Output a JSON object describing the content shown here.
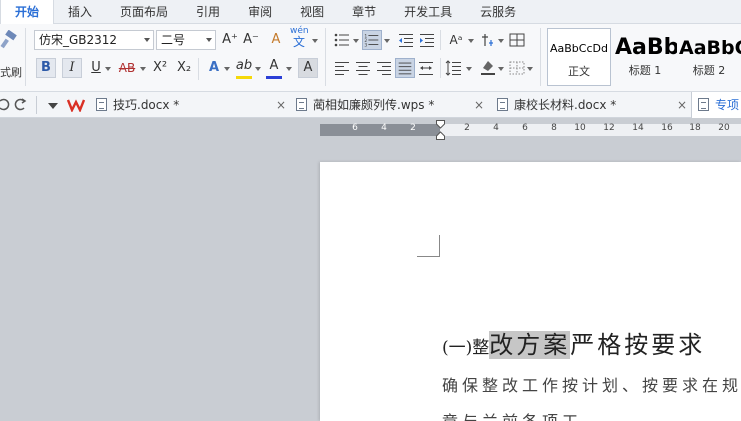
{
  "menu": {
    "tabs": [
      "开始",
      "插入",
      "页面布局",
      "引用",
      "审阅",
      "视图",
      "章节",
      "开发工具",
      "云服务"
    ],
    "active_tab": "开始"
  },
  "ribbon": {
    "paste_label_fragment": "式刷",
    "font_name": "仿宋_GB2312",
    "font_size": "二号",
    "font_grow": "A⁺",
    "font_shrink": "A⁻",
    "clear_format": "A",
    "phonetic_top": "wén",
    "phonetic_bottom": "文",
    "bold": "B",
    "italic": "I",
    "underline": "U",
    "strikethrough": "AB",
    "superscript": "X²",
    "subscript": "X₂",
    "text_effect": "A",
    "highlight": "ab",
    "font_color": "A",
    "char_shading": "A",
    "font_color_hex": "#e02020",
    "highlight_hex": "#f5d90a",
    "styles": [
      {
        "sample": "AaBbCcDd",
        "name": "正文"
      },
      {
        "sample": "AaBb",
        "name": "标题 1"
      },
      {
        "sample": "AaBbC",
        "name": "标题 2"
      }
    ]
  },
  "doc_tabs": [
    {
      "label": "技巧.docx *",
      "icon": "word-doc-icon"
    },
    {
      "label": "蔺相如廉颇列传.wps *",
      "icon": "word-doc-icon"
    },
    {
      "label": "康校长材料.docx *",
      "icon": "word-doc-icon"
    },
    {
      "label": "专项",
      "icon": "word-doc-icon"
    }
  ],
  "ruler": {
    "left_numbers": [
      "6",
      "4",
      "2"
    ],
    "right_numbers": [
      "2",
      "4",
      "6",
      "8",
      "10",
      "12",
      "14",
      "16",
      "18",
      "20"
    ]
  },
  "document": {
    "heading_prefix": "(一)整",
    "heading_selected": "改方案",
    "heading_rest": "严格按要求",
    "line2": "确保整改工作按计划、按要求在规",
    "line3": "章与兰前各项工"
  }
}
